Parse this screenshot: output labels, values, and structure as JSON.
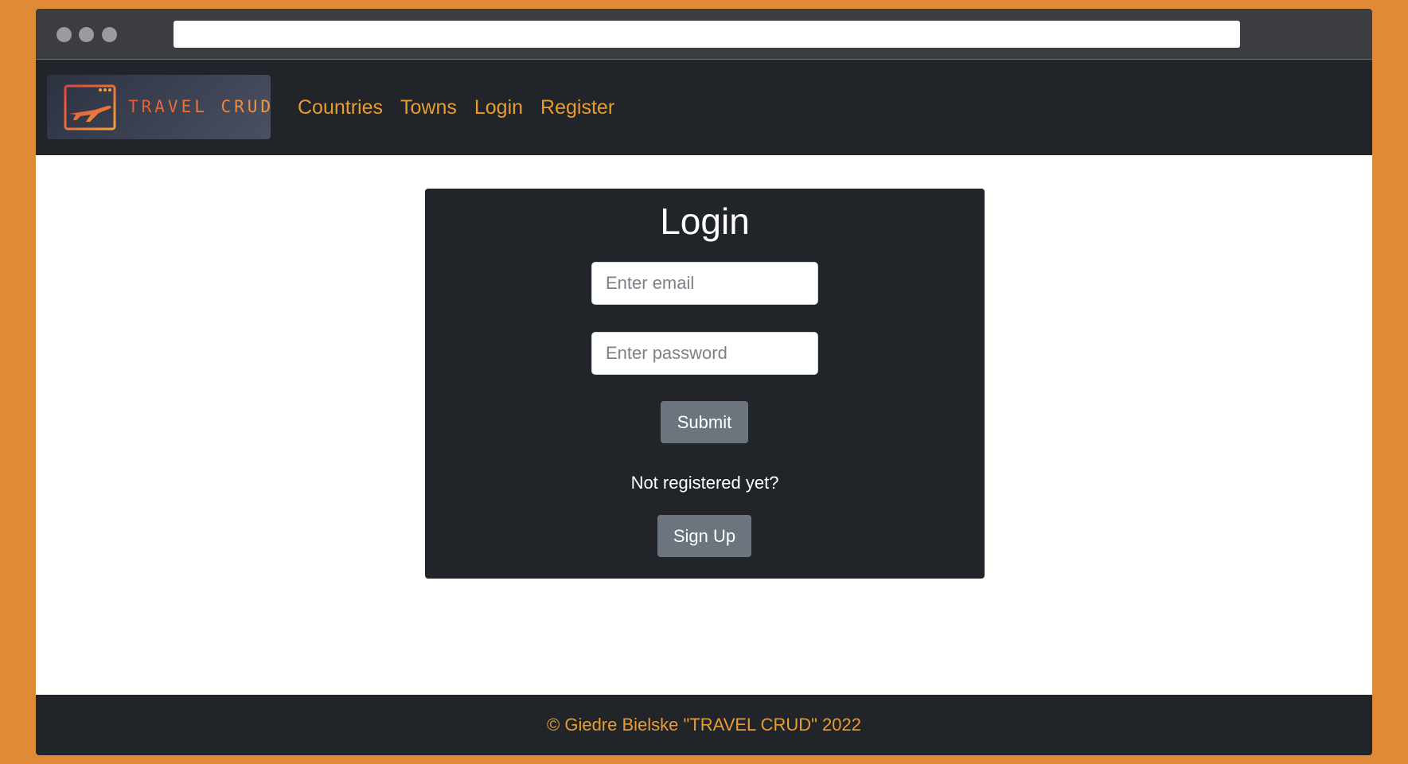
{
  "browser": {
    "url": ""
  },
  "brand": {
    "logo_text": "TRAVEL CRUD",
    "icon": "airplane-window-icon"
  },
  "nav": {
    "links": [
      "Countries",
      "Towns",
      "Login",
      "Register"
    ]
  },
  "login": {
    "title": "Login",
    "email_placeholder": "Enter email",
    "password_placeholder": "Enter password",
    "submit_label": "Submit",
    "prompt": "Not registered yet?",
    "signup_label": "Sign Up"
  },
  "footer": {
    "text": "© Giedre Bielske \"TRAVEL CRUD\" 2022"
  },
  "colors": {
    "page_background": "#e08a38",
    "navbar": "#212529",
    "accent": "#e99c2e",
    "button": "#6c757d"
  }
}
